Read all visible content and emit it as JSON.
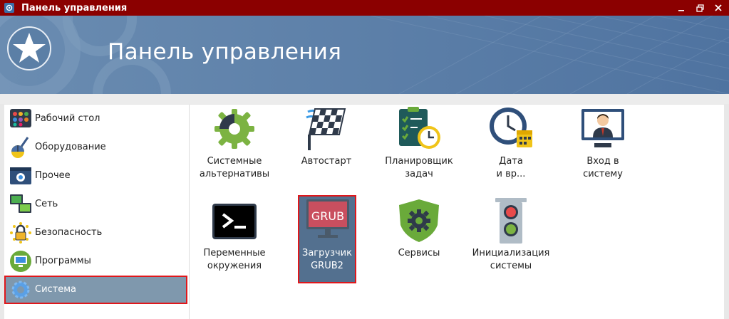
{
  "window": {
    "title": "Панель управления",
    "controls": [
      "minimize",
      "maximize",
      "close"
    ]
  },
  "banner": {
    "title": "Панель управления"
  },
  "sidebar": {
    "items": [
      {
        "label": "Рабочий стол",
        "icon": "desktop-palette-icon"
      },
      {
        "label": "Оборудование",
        "icon": "mouse-pen-icon"
      },
      {
        "label": "Прочее",
        "icon": "window-gear-icon"
      },
      {
        "label": "Сеть",
        "icon": "network-monitors-icon"
      },
      {
        "label": "Безопасность",
        "icon": "lock-sun-icon"
      },
      {
        "label": "Программы",
        "icon": "monitor-icon"
      },
      {
        "label": "Система",
        "icon": "system-gear-icon",
        "active": true
      }
    ]
  },
  "main": {
    "tiles": [
      {
        "label": "Системные\nальтернативы",
        "icon": "gear-icon"
      },
      {
        "label": "Автостарт",
        "icon": "checkered-flag-icon"
      },
      {
        "label": "Планировщик\nзадач",
        "icon": "task-clock-icon"
      },
      {
        "label": "Дата\nи вр...",
        "icon": "clock-calendar-icon"
      },
      {
        "label": "Вход в\nсистему",
        "icon": "user-monitor-icon"
      },
      {
        "label": "Переменные\nокружения",
        "icon": "terminal-icon"
      },
      {
        "label": "Загрузчик\nGRUB2",
        "icon": "grub-icon",
        "icon_text": "GRUB",
        "selected": true
      },
      {
        "label": "Сервисы",
        "icon": "shield-gear-icon"
      },
      {
        "label": "Инициализация\nсистемы",
        "icon": "traffic-light-icon"
      }
    ]
  },
  "colors": {
    "titlebar": "#8b0000",
    "banner": "#5b7fa6",
    "selection": "#53708f",
    "highlight": "#e0171b"
  }
}
